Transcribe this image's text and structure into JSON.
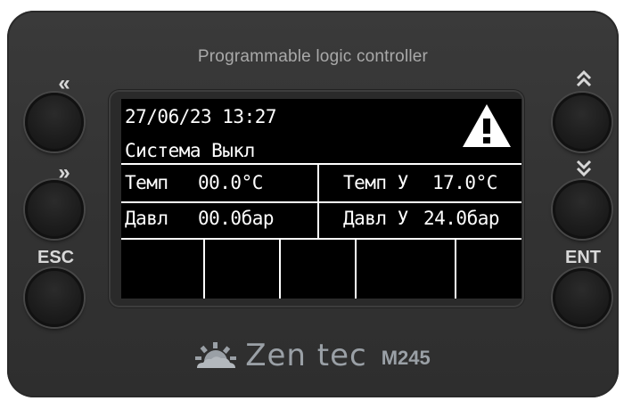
{
  "device": {
    "title": "Programmable logic controller",
    "brand": "Zen tec",
    "model": "M245"
  },
  "buttons": {
    "left_top": {
      "label": "«",
      "icon": "double-chevron-left-icon"
    },
    "left_mid": {
      "label": "»",
      "icon": "double-chevron-right-icon"
    },
    "left_bottom": {
      "label": "ESC"
    },
    "right_top": {
      "label": "⌃⌃",
      "icon": "double-chevron-up-icon"
    },
    "right_mid": {
      "label": "⌄⌄",
      "icon": "double-chevron-down-icon"
    },
    "right_bottom": {
      "label": "ENT"
    }
  },
  "screen": {
    "datetime": "27/06/23 13:27",
    "system_status": "Система Выкл",
    "warning_icon": "warning-triangle-icon",
    "temp_label": "Темп",
    "temp_value": "00.0°C",
    "temp_set_label": "Темп У",
    "temp_set_value": "17.0°C",
    "press_label": "Давл",
    "press_value": "00.0бар",
    "press_set_label": "Давл У",
    "press_set_value": "24.0бар"
  },
  "colors": {
    "body": "#353535",
    "lcd_background": "#000000",
    "lcd_text": "#ffffff",
    "label_text": "#d8d8d8",
    "brand": "#9aa0a6"
  }
}
